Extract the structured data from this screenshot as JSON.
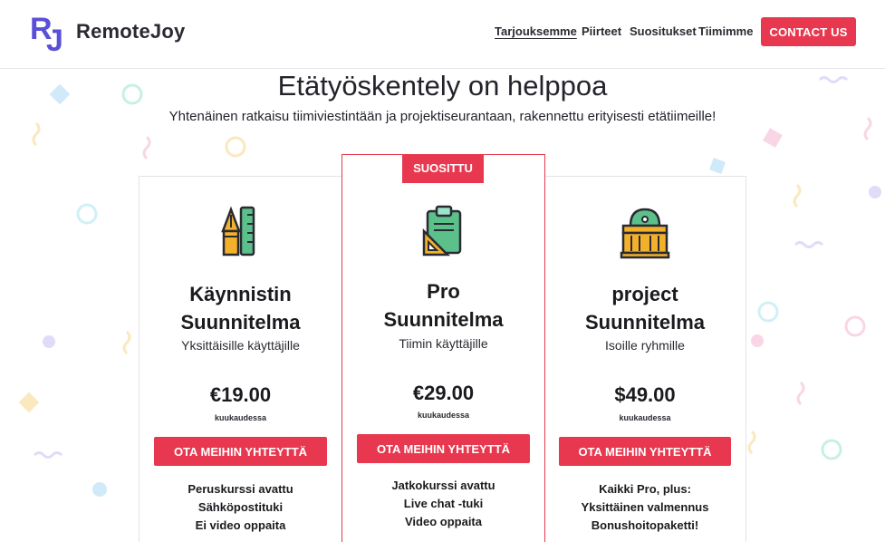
{
  "brand": {
    "name": "RemoteJoy",
    "logo_letters": "RJ"
  },
  "nav": {
    "items": [
      {
        "label": "Tarjouksemme",
        "active": true
      },
      {
        "label": "Piirteet",
        "active": false
      },
      {
        "label": "Suositukset",
        "active": false
      },
      {
        "label": "Tiimimme",
        "active": false
      }
    ],
    "contact_label": "CONTACT US"
  },
  "hero": {
    "title": "Etätyöskentely on helppoa",
    "subtitle": "Yhtenäinen ratkaisu tiimiviestintään ja projektiseurantaan, rakennettu erityisesti etätiimeille!"
  },
  "plans": [
    {
      "icon": "pen-ruler-icon",
      "title_line1": "Käynnistin",
      "title_line2": "Suunnitelma",
      "subtitle": "Yksittäisille käyttäjille",
      "price": "€19.00",
      "period": "kuukaudessa",
      "cta": "OTA MEIHIN YHTEYTTÄ",
      "features": [
        "Peruskurssi avattu",
        "Sähköpostituki",
        "Ei video oppaita"
      ]
    },
    {
      "badge": "SUOSITTU",
      "icon": "clipboard-icon",
      "title_line1": "Pro",
      "title_line2": "Suunnitelma",
      "subtitle": "Tiimin käyttäjille",
      "price": "€29.00",
      "period": "kuukaudessa",
      "cta": "OTA MEIHIN YHTEYTTÄ",
      "features": [
        "Jatkokurssi avattu",
        "Live chat -tuki",
        "Video oppaita"
      ]
    },
    {
      "icon": "building-icon",
      "title_line1": "project",
      "title_line2": "Suunnitelma",
      "subtitle": "Isoille ryhmille",
      "price": "$49.00",
      "period": "kuukaudessa",
      "cta": "OTA MEIHIN YHTEYTTÄ",
      "features": [
        "Kaikki Pro, plus:",
        "Yksittäinen valmennus",
        "Bonushoitopaketti!"
      ]
    }
  ],
  "colors": {
    "accent": "#e8384f",
    "brand_logo": "#5b4fd6",
    "text": "#1b1b1f"
  }
}
